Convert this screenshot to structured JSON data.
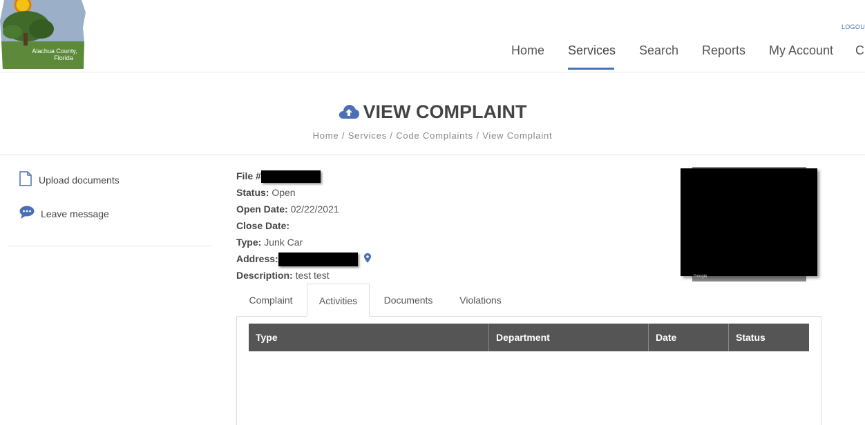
{
  "header": {
    "logo_text_line1": "Alachua County,",
    "logo_text_line2": "Florida",
    "logout_label": "LOGOUT",
    "nav": [
      {
        "label": "Home"
      },
      {
        "label": "Services",
        "active": true
      },
      {
        "label": "Search"
      },
      {
        "label": "Reports"
      },
      {
        "label": "My Account"
      },
      {
        "label": "C"
      }
    ]
  },
  "title": {
    "icon": "cloud-upload-icon",
    "text": "VIEW COMPLAINT",
    "breadcrumb": [
      "Home",
      "Services",
      "Code Complaints",
      "View Complaint"
    ],
    "separator": "/"
  },
  "sidebar": {
    "items": [
      {
        "icon": "file-icon",
        "label": "Upload documents"
      },
      {
        "icon": "chat-bubble-icon",
        "label": "Leave message"
      }
    ]
  },
  "complaint": {
    "file_label": "File #",
    "status_label": "Status:",
    "status_value": "Open",
    "open_date_label": "Open Date:",
    "open_date_value": "02/22/2021",
    "close_date_label": "Close Date:",
    "close_date_value": "",
    "type_label": "Type:",
    "type_value": "Junk Car",
    "address_label": "Address:",
    "description_label": "Description:",
    "description_value": "test test"
  },
  "map": {
    "attribution": "Google"
  },
  "tabs": [
    {
      "label": "Complaint"
    },
    {
      "label": "Activities",
      "active": true
    },
    {
      "label": "Documents"
    },
    {
      "label": "Violations"
    }
  ],
  "activities_table": {
    "columns": [
      "Type",
      "Department",
      "Date",
      "Status"
    ],
    "rows": []
  },
  "colors": {
    "accent": "#4a6fb5",
    "table_header_bg": "#555555"
  }
}
